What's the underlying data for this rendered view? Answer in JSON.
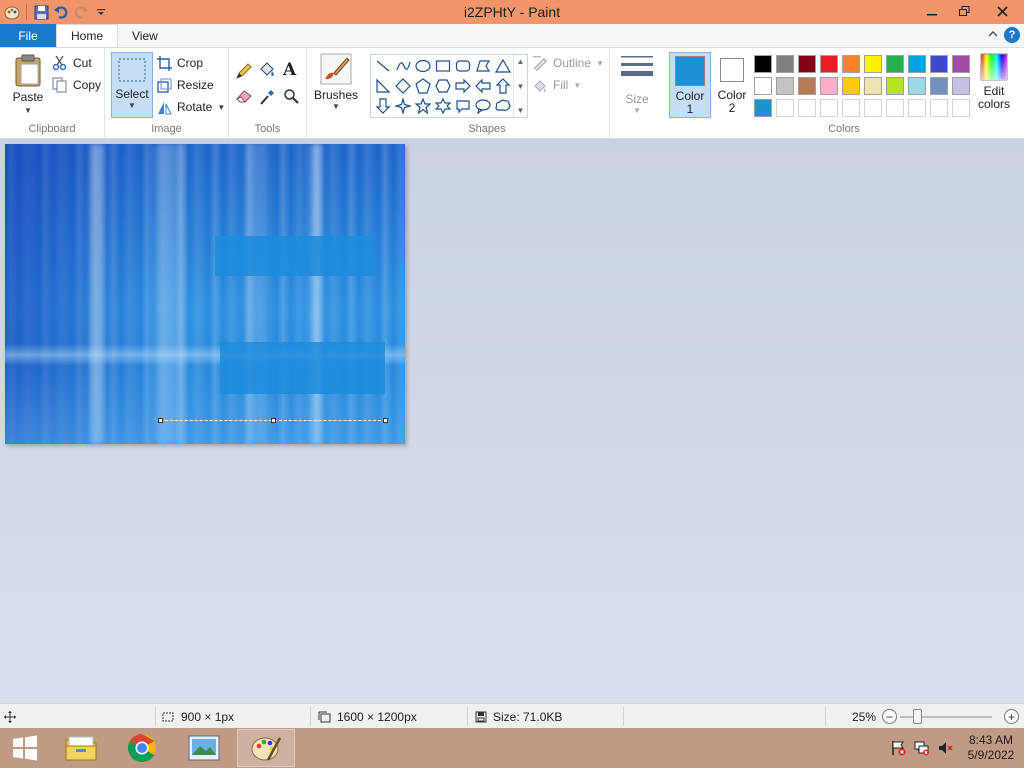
{
  "window": {
    "title": "i2ZPHtY - Paint"
  },
  "tabs": {
    "file": "File",
    "home": "Home",
    "view": "View"
  },
  "ribbon": {
    "clipboard": {
      "label": "Clipboard",
      "paste": "Paste",
      "cut": "Cut",
      "copy": "Copy"
    },
    "image": {
      "label": "Image",
      "select": "Select",
      "crop": "Crop",
      "resize": "Resize",
      "rotate": "Rotate"
    },
    "tools": {
      "label": "Tools"
    },
    "brushes": {
      "label": "Brushes"
    },
    "shapes": {
      "label": "Shapes",
      "outline": "Outline",
      "fill": "Fill"
    },
    "size": {
      "label": "Size"
    },
    "colors": {
      "label": "Colors",
      "color1_line1": "Color",
      "color1_line2": "1",
      "color2_line1": "Color",
      "color2_line2": "2",
      "edit_line1": "Edit",
      "edit_line2": "colors",
      "color1_value": "#1f8fd6",
      "color2_value": "#ffffff",
      "palette": [
        "#000000",
        "#7f7f7f",
        "#880015",
        "#ed1c24",
        "#ff7f27",
        "#fff200",
        "#22b14c",
        "#00a2e8",
        "#3f48cc",
        "#a349a4",
        "#ffffff",
        "#c3c3c3",
        "#b97a57",
        "#ffaec9",
        "#ffc90e",
        "#efe4b0",
        "#b5e61d",
        "#99d9ea",
        "#7092be",
        "#c8bfe7",
        "#1f8fd6",
        "#ffffff",
        "#ffffff",
        "#ffffff",
        "#ffffff",
        "#ffffff",
        "#ffffff",
        "#ffffff",
        "#ffffff",
        "#ffffff"
      ]
    }
  },
  "status": {
    "selection_size": "900 × 1px",
    "image_size": "1600 × 1200px",
    "file_size": "Size: 71.0KB",
    "zoom": "25%",
    "zoom_fraction": 0.25
  },
  "taskbar": {
    "time": "8:43 AM",
    "date": "5/9/2022"
  }
}
